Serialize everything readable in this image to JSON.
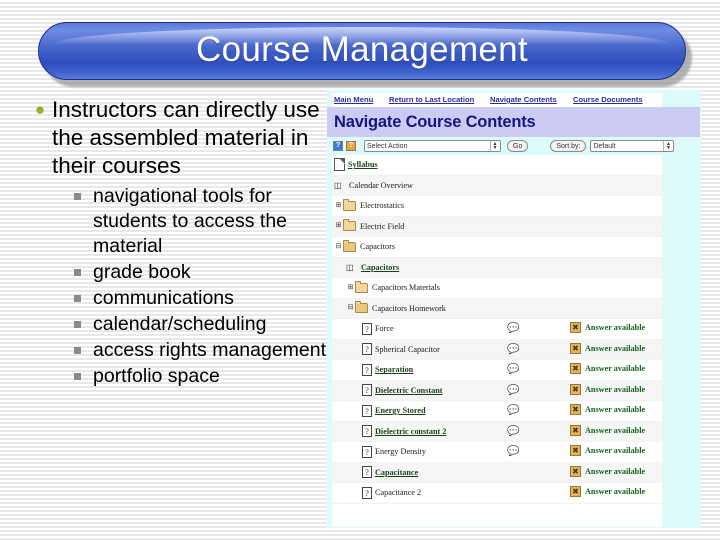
{
  "slide": {
    "title": "Course Management"
  },
  "bullets": {
    "level1": "Instructors can directly use the assembled material in their courses",
    "level2": [
      "navigational tools for students to access the material",
      "grade book",
      "communications",
      "calendar/scheduling",
      "access rights management",
      "portfolio space"
    ]
  },
  "screenshot": {
    "nav": {
      "main_menu": "Main Menu",
      "return_to_last_location": "Return to Last Location",
      "navigate_contents": "Navigate Contents",
      "course_documents": "Course Documents"
    },
    "heading": "Navigate Course Contents",
    "toolbar": {
      "help_blue": "?",
      "help_orange": "?",
      "select_action": "Select Action",
      "go": "Go",
      "sort_by_label": "Sort by:",
      "sort_value": "Default"
    },
    "answer_label": "Answer available",
    "tree": [
      {
        "label": "Syllabus",
        "icon": "document-icon",
        "indent": 0,
        "link": true,
        "handle": "",
        "discussion": false,
        "answer": false
      },
      {
        "label": "Calendar Overview",
        "icon": "calendar-icon",
        "indent": 0,
        "link": false,
        "handle": "",
        "discussion": false,
        "answer": false
      },
      {
        "label": "Electrostatics",
        "icon": "folder-icon",
        "indent": 0,
        "link": false,
        "handle": "+",
        "discussion": false,
        "answer": false
      },
      {
        "label": "Electric Field",
        "icon": "folder-icon",
        "indent": 0,
        "link": false,
        "handle": "+",
        "discussion": false,
        "answer": false
      },
      {
        "label": "Capacitors",
        "icon": "folder-open-icon",
        "indent": 0,
        "link": false,
        "handle": "-",
        "discussion": false,
        "answer": false
      },
      {
        "label": "Capacitors",
        "icon": "calendar-icon",
        "indent": 1,
        "link": true,
        "handle": "",
        "discussion": false,
        "answer": false
      },
      {
        "label": "Capacitors Materials",
        "icon": "folder-icon",
        "indent": 1,
        "link": false,
        "handle": "+",
        "discussion": false,
        "answer": false
      },
      {
        "label": "Capacitors Homework",
        "icon": "folder-open-icon",
        "indent": 1,
        "link": false,
        "handle": "-",
        "discussion": false,
        "answer": false
      },
      {
        "label": "Force",
        "icon": "question-icon",
        "indent": 2,
        "link": false,
        "handle": "",
        "discussion": true,
        "answer": true
      },
      {
        "label": "Spherical Capacitor",
        "icon": "question-icon",
        "indent": 2,
        "link": false,
        "handle": "",
        "discussion": true,
        "answer": true
      },
      {
        "label": "Separation",
        "icon": "question-icon",
        "indent": 2,
        "link": true,
        "handle": "",
        "discussion": true,
        "answer": true
      },
      {
        "label": "Dielectric Constant",
        "icon": "question-icon",
        "indent": 2,
        "link": true,
        "handle": "",
        "discussion": true,
        "answer": true
      },
      {
        "label": "Energy Stored",
        "icon": "question-icon",
        "indent": 2,
        "link": true,
        "handle": "",
        "discussion": true,
        "answer": true
      },
      {
        "label": "Dielectric constant 2",
        "icon": "question-icon",
        "indent": 2,
        "link": true,
        "handle": "",
        "discussion": true,
        "answer": true
      },
      {
        "label": "Energy Density",
        "icon": "question-icon",
        "indent": 2,
        "link": false,
        "handle": "",
        "discussion": true,
        "answer": true
      },
      {
        "label": "Capacitance",
        "icon": "question-icon",
        "indent": 2,
        "link": true,
        "handle": "",
        "discussion": false,
        "answer": true
      },
      {
        "label": "Capacitance 2",
        "icon": "question-icon",
        "indent": 2,
        "link": false,
        "handle": "",
        "discussion": false,
        "answer": true
      }
    ]
  },
  "colors": {
    "title_blue": "#3c5cc4",
    "heading_lavender": "#ccccf2",
    "panel_cyan": "#ddfbfb",
    "answer_green": "#14621f",
    "bullet_olive": "#9aab2c"
  }
}
